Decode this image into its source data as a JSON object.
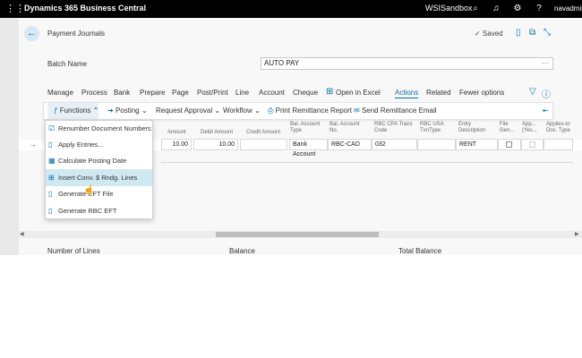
{
  "topbar": {
    "app_title": "Dynamics 365 Business Central",
    "environment": "WSISandbox",
    "user": "navadmin",
    "icons": [
      "waffle-icon",
      "search-icon",
      "bell-icon",
      "gear-icon",
      "help-icon"
    ]
  },
  "header": {
    "page_title": "Payment Journals",
    "saved_label": "✓ Saved"
  },
  "batch": {
    "label": "Batch Name",
    "value": "AUTO PAY"
  },
  "menu": {
    "items": [
      "Manage",
      "Process",
      "Bank",
      "Prepare",
      "Page",
      "Post/Print",
      "Line",
      "Account",
      "Cheque",
      "Open in Excel",
      "Actions",
      "Related",
      "Fewer options"
    ],
    "active": "Actions"
  },
  "actionbar": {
    "functions": "Functions",
    "posting": "Posting",
    "request_approval": "Request Approval",
    "workflow": "Workflow",
    "print_remittance": "Print Remittance Report",
    "send_remittance": "Send Remittance Email"
  },
  "grid": {
    "columns": [
      "Amount",
      "Debit Amount",
      "Credit Amount",
      "Bal. Account Type",
      "Bal. Account No.",
      "RBC CPA Trans Code",
      "RBC USA TxnType",
      "Entry Description",
      "File Gen...",
      "App... (Yes...",
      "Applies-to Doc. Type"
    ],
    "rows": [
      {
        "amount": "10.00",
        "debit": "10.00",
        "credit": "",
        "bal_type": "Bank Account",
        "bal_no": "RBC-CAD",
        "cpa_code": "032",
        "usa_type": "",
        "entry_desc": "RENT"
      }
    ]
  },
  "dropdown": {
    "items": [
      "Renumber Document Numbers",
      "Apply Entries...",
      "Calculate Posting Date",
      "Insert Conv. $ Rndg. Lines",
      "Generate EFT File",
      "Generate RBC EFT"
    ],
    "highlighted_index": 3
  },
  "footer": {
    "number_of_lines": "Number of Lines",
    "balance": "Balance",
    "total_balance": "Total Balance"
  }
}
